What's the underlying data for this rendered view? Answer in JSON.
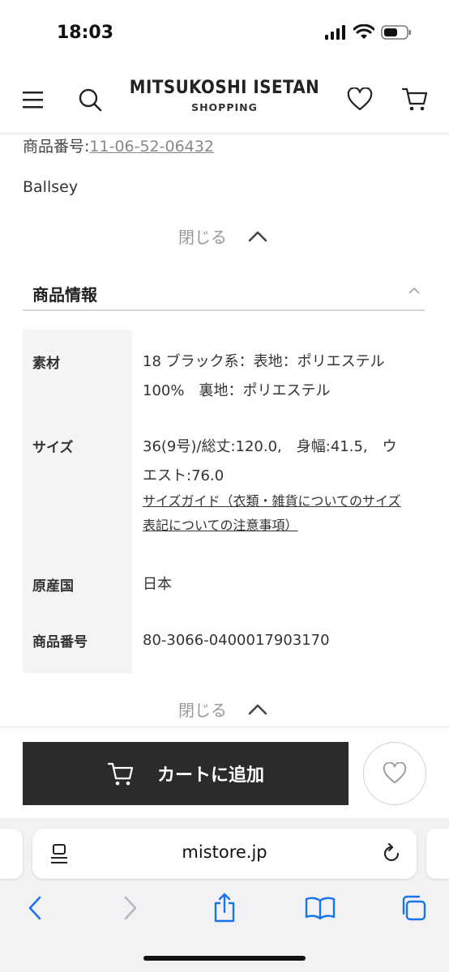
{
  "status_bar": {
    "time": "18:03"
  },
  "header": {
    "brand_main": "MITSUKOSHI ISETAN",
    "brand_sub": "SHOPPING",
    "icons": [
      "menu-icon",
      "search-icon",
      "heart-icon",
      "cart-icon"
    ]
  },
  "product_number_line": {
    "label": "商品番号:",
    "value": "11-06-52-06432"
  },
  "brand_name": "Ballsey",
  "close_label": "閉じる",
  "section": {
    "title": "商品情報"
  },
  "info_table": {
    "material": {
      "label": "素材",
      "line1": "18 ブラック系：表地：ポリエステル",
      "line2": "100%　裏地：ポリエステル"
    },
    "size": {
      "label": "サイズ",
      "line1": "36(9号)/総丈:120.0,　身幅:41.5,　ウ",
      "line2": "エスト:76.0",
      "guide_line1": "サイズガイド（衣類・雑貨についてのサイズ",
      "guide_line2": "表記についての注意事項）"
    },
    "origin": {
      "label": "原産国",
      "value": "日本"
    },
    "item_number": {
      "label": "商品番号",
      "value": "80-3066-0400017903170"
    }
  },
  "cart": {
    "add_label": "カートに追加"
  },
  "browser": {
    "url": "mistore.jp"
  },
  "colors": {
    "cart_button": "#2b2b2b",
    "link_gray": "#888888",
    "ios_blue": "#1a73e8"
  }
}
